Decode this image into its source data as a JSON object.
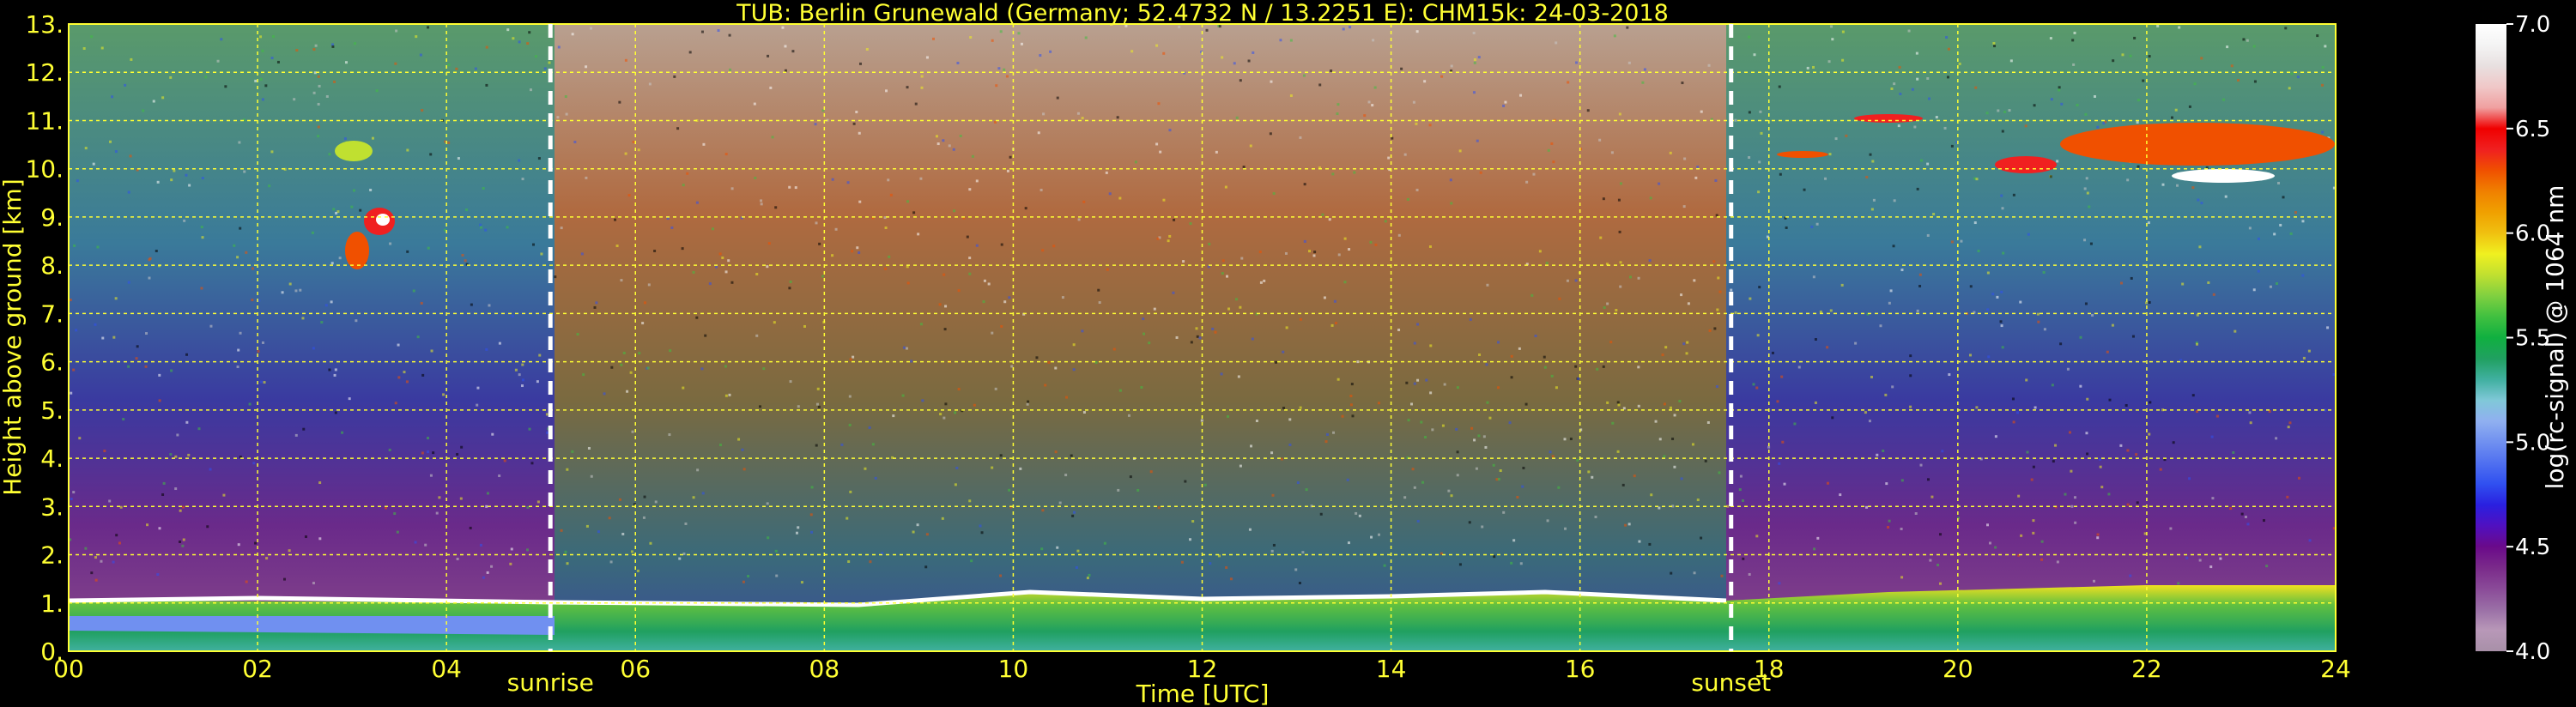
{
  "chart_data": {
    "type": "heatmap",
    "title": "TUB: Berlin Grunewald (Germany; 52.4732 N / 13.2251 E):    CHM15k: 24-03-2018",
    "xlabel": "Time [UTC]",
    "ylabel": "Height above ground [km]",
    "xlim": [
      0,
      24
    ],
    "ylim": [
      0,
      13
    ],
    "x_ticks": [
      "00",
      "02",
      "04",
      "06",
      "08",
      "10",
      "12",
      "14",
      "16",
      "18",
      "20",
      "22",
      "24"
    ],
    "y_ticks": [
      "0.",
      "1.",
      "2.",
      "3.",
      "4.",
      "5.",
      "6.",
      "7.",
      "8.",
      "9.",
      "10.",
      "11.",
      "12.",
      "13."
    ],
    "grid": true,
    "events": [
      {
        "label": "sunrise",
        "x": 5.1
      },
      {
        "label": "sunset",
        "x": 17.6
      }
    ],
    "colorbar": {
      "label": "log(rc-signal) @ 1064 nm",
      "range": [
        4.0,
        7.0
      ],
      "ticks": [
        "4.0",
        "4.5",
        "5.0",
        "5.5",
        "6.0",
        "6.5",
        "7.0"
      ],
      "colors": [
        "#a890a8",
        "#b898b8",
        "#9a6fa6",
        "#8a4a98",
        "#7a2a8a",
        "#6a0a8a",
        "#5010c0",
        "#2a20e0",
        "#3050f0",
        "#5070f0",
        "#7090f0",
        "#90b0f0",
        "#80c8d8",
        "#40b0a0",
        "#20a060",
        "#10b040",
        "#40c040",
        "#80d040",
        "#c0e030",
        "#f0f020",
        "#f0c010",
        "#f0a000",
        "#f08000",
        "#f05000",
        "#f02020",
        "#f00000",
        "#f0a0a0",
        "#f0c8c8",
        "#e8e0e0",
        "#f4f4f4",
        "#ffffff"
      ]
    }
  }
}
